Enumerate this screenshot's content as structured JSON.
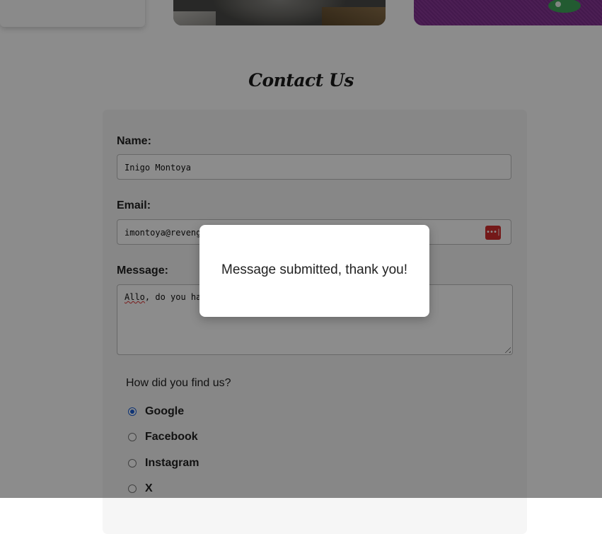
{
  "page": {
    "title": "Contact Us"
  },
  "form": {
    "name_label": "Name:",
    "name_value": "Inigo Montoya",
    "email_label": "Email:",
    "email_value": "imontoya@revenge.com",
    "message_label": "Message:",
    "message_value_misspelled": "Allo",
    "message_value_rest": ", do you have a ...",
    "how_label": "How did you find us?",
    "options": [
      {
        "label": "Google",
        "checked": true
      },
      {
        "label": "Facebook",
        "checked": false
      },
      {
        "label": "Instagram",
        "checked": false
      },
      {
        "label": "X",
        "checked": false
      }
    ]
  },
  "modal": {
    "message": "Message submitted, thank you!"
  },
  "icons": {
    "password_manager": "password-manager-icon",
    "password_manager_glyph": "•••|"
  },
  "colors": {
    "accent_radio": "#1a5fd6",
    "password_icon_bg": "#d32f2f",
    "overlay": "rgba(0,0,0,0.45)"
  }
}
